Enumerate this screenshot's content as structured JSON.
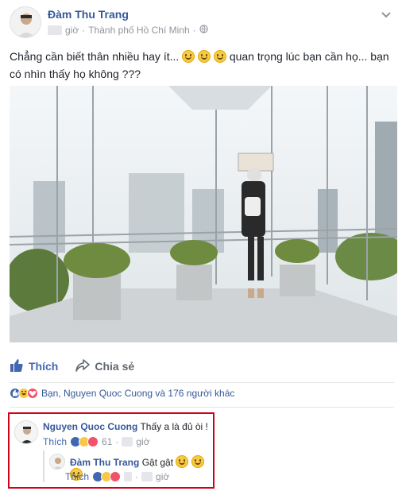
{
  "post": {
    "author": "Đàm Thu Trang",
    "time_suffix": "giờ",
    "separator": "·",
    "location": "Thành phố Hồ Chí Minh",
    "text_part1": "Chẳng cần biết thân nhiều hay ít...",
    "text_part2": "quan trọng lúc bạn cần họ... bạn có nhìn thấy họ không ???"
  },
  "actions": {
    "like_label": "Thích",
    "share_label": "Chia sẻ"
  },
  "reactions": {
    "summary": "Bạn, Nguyen Quoc Cuong và 176 người khác"
  },
  "comments": [
    {
      "name": "Nguyen Quoc Cuong",
      "text": "Thấy a là đủ òi !",
      "like_label": "Thích",
      "separator": "·",
      "count": "61",
      "time_suffix": "giờ"
    },
    {
      "name": "Đàm Thu Trang",
      "text": "Gật gật",
      "like_label": "Thích",
      "separator": "·",
      "time_suffix": "giờ"
    }
  ],
  "icons": [
    "avatar",
    "chevron-down-icon",
    "globe-icon",
    "smile-emoji-icon",
    "like-icon",
    "share-icon",
    "like-reaction-icon",
    "haha-reaction-icon",
    "love-reaction-icon"
  ],
  "colors": {
    "link": "#365899",
    "meta": "#90949c",
    "like_blue": "#4267b2",
    "highlight_border": "#d0021b"
  }
}
